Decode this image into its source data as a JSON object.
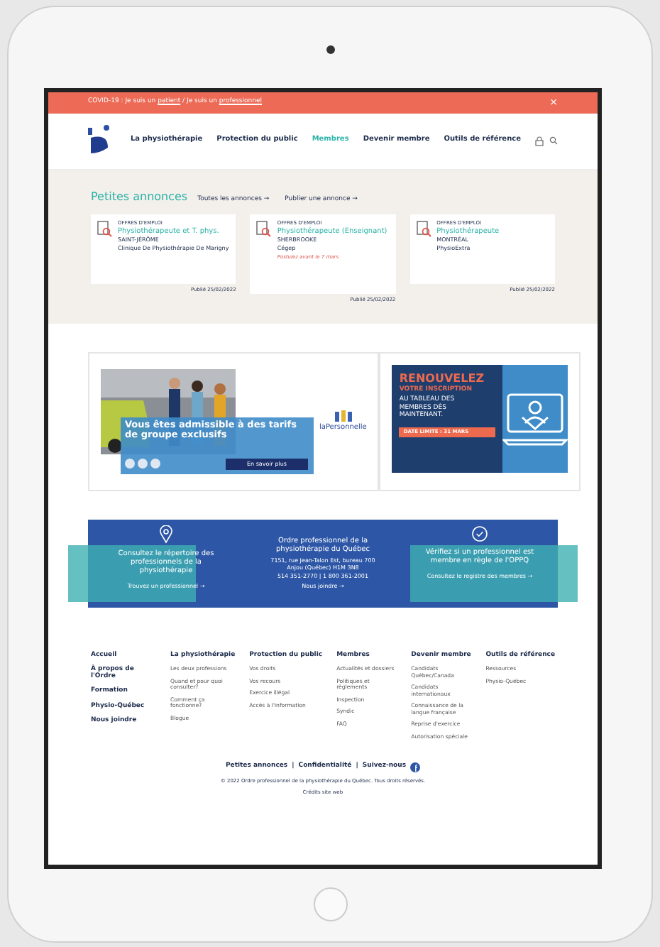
{
  "alert_bar": {
    "prefix": "COVID-19 : Je suis un ",
    "link_1": "patient",
    "separator": " / Je suis un ",
    "link_2": "professionnel",
    "close": "×"
  },
  "nav": {
    "items": [
      {
        "label": "La physiothérapie",
        "selected": false
      },
      {
        "label": "Protection du public",
        "selected": false
      },
      {
        "label": "Membres",
        "selected": true
      },
      {
        "label": "Devenir membre",
        "selected": false
      },
      {
        "label": "Outils de référence",
        "selected": false
      }
    ]
  },
  "classifieds": {
    "title": "Petites annonces",
    "links": [
      "Toutes les annonces →",
      "Publier une annonce →"
    ],
    "cards": [
      {
        "category": "OFFRES D'EMPLOI",
        "title": "Physiothérapeute et T. phys.",
        "city": "SAINT-JÉRÔME",
        "employer": "Clinique De Physiothérapie De Marigny",
        "date": "Publié 25/02/2022"
      },
      {
        "category": "OFFRES D'EMPLOI",
        "title": "Physiothérapeute (Enseignant)",
        "city": "SHERBROOKE",
        "employer": "Cégep",
        "deadline": "Postulez avant le 7 mars",
        "date": "Publié 25/02/2022"
      },
      {
        "category": "OFFRES D'EMPLOI",
        "title": "Physiothérapeute",
        "city": "MONTRÉAL",
        "employer": "PhysioExtra",
        "date": "Publié 25/02/2022"
      }
    ]
  },
  "ads": [
    {
      "kind": "insurance",
      "brand": "laPersonnelle",
      "headline": "Vous êtes admissible à des tarifs de groupe exclusifs",
      "button": "En savoir plus"
    },
    {
      "kind": "renewal",
      "headline_1": "RENOUVELEZ",
      "headline_2": "VOTRE INSCRIPTION",
      "body": "AU TABLEAU DES MEMBRES DÈS MAINTENANT.",
      "deadline": "DATE LIMITE : 31 MARS"
    }
  ],
  "info_band": {
    "left": {
      "text": "Consultez le répertoire des professionnels de la physiothérapie",
      "link": "Trouvez un professionnel →"
    },
    "center": {
      "title": "Ordre professionnel de la physiothérapie du Québec",
      "address_1": "7151, rue Jean-Talon Est, bureau 700",
      "address_2": "Anjou (Québec) H1M 3N8",
      "phone": "514 351-2770 | 1 800 361-2001",
      "link": "Nous joindre →"
    },
    "right": {
      "text": "Vérifiez si un professionnel est membre en règle de l'OPPQ",
      "link": "Consultez le registre des membres →"
    }
  },
  "footer": {
    "main_links": [
      "Accueil",
      "À propos de l'Ordre",
      "Formation",
      "Physio-Québec",
      "Nous joindre"
    ],
    "columns": [
      {
        "title": "La physiothérapie",
        "links": [
          "Les deux professions",
          "Quand et pour quoi consulter?",
          "Comment ça fonctionne?",
          "Blogue"
        ]
      },
      {
        "title": "Protection du public",
        "links": [
          "Vos droits",
          "Vos recours",
          "Exercice illégal",
          "Accès à l'information"
        ]
      },
      {
        "title": "Membres",
        "links": [
          "Actualités et dossiers",
          "Politiques et règlements",
          "Inspection",
          "Syndic",
          "FAQ"
        ]
      },
      {
        "title": "Devenir membre",
        "links": [
          "Candidats Québec/Canada",
          "Candidats internationaux",
          "Connaissance de la langue française",
          "Reprise d'exercice",
          "Autorisation spéciale"
        ]
      },
      {
        "title": "Outils de référence",
        "links": [
          "Ressources",
          "Physio-Québec"
        ]
      }
    ],
    "bottom_links": [
      "Petites annonces",
      "|",
      "Confidentialité",
      "|",
      "Suivez-nous"
    ],
    "copyright": "© 2022 Ordre professionnel de la physiothérapie du Québec. Tous droits réservés.",
    "credits": "Crédits site web"
  }
}
